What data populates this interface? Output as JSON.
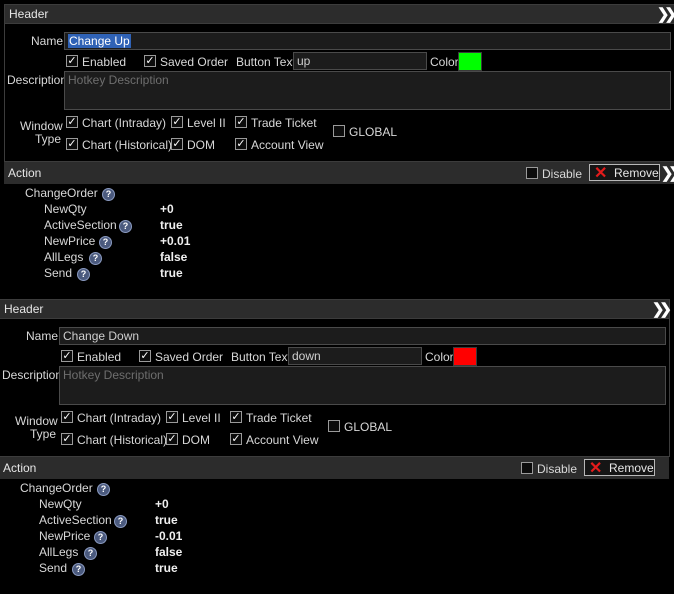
{
  "hotkeys": [
    {
      "header_title": "Header",
      "name_label": "Name",
      "name_value": "Change Up",
      "enabled_label": "Enabled",
      "enabled": true,
      "saved_order_label": "Saved Order",
      "saved_order": true,
      "button_text_label": "Button Text",
      "button_text_value": "up",
      "color_label": "Color",
      "color": "#00ff00",
      "description_label": "Description",
      "description_placeholder": "Hotkey Description",
      "window_type_label_1": "Window",
      "window_type_label_2": "Type",
      "window_types": {
        "chart_intraday": "Chart (Intraday)",
        "level2": "Level II",
        "trade_ticket": "Trade Ticket",
        "chart_historical": "Chart (Historical)",
        "dom": "DOM",
        "account_view": "Account View",
        "global": "GLOBAL"
      },
      "action_title": "Action",
      "disable_label": "Disable",
      "remove_label": "Remove",
      "action_name": "ChangeOrder",
      "params": [
        {
          "key": "NewQty",
          "value": "+0"
        },
        {
          "key": "ActiveSection",
          "value": "true"
        },
        {
          "key": "NewPrice",
          "value": "+0.01"
        },
        {
          "key": "AllLegs",
          "value": "false"
        },
        {
          "key": "Send",
          "value": "true"
        }
      ]
    },
    {
      "header_title": "Header",
      "name_label": "Name",
      "name_value": "Change Down",
      "enabled_label": "Enabled",
      "enabled": true,
      "saved_order_label": "Saved Order",
      "saved_order": true,
      "button_text_label": "Button Text",
      "button_text_value": "down",
      "color_label": "Color",
      "color": "#ff0000",
      "description_label": "Description",
      "description_placeholder": "Hotkey Description",
      "window_type_label_1": "Window",
      "window_type_label_2": "Type",
      "window_types": {
        "chart_intraday": "Chart (Intraday)",
        "level2": "Level II",
        "trade_ticket": "Trade Ticket",
        "chart_historical": "Chart (Historical)",
        "dom": "DOM",
        "account_view": "Account View",
        "global": "GLOBAL"
      },
      "action_title": "Action",
      "disable_label": "Disable",
      "remove_label": "Remove",
      "action_name": "ChangeOrder",
      "params": [
        {
          "key": "NewQty",
          "value": "+0"
        },
        {
          "key": "ActiveSection",
          "value": "true"
        },
        {
          "key": "NewPrice",
          "value": "-0.01"
        },
        {
          "key": "AllLegs",
          "value": "false"
        },
        {
          "key": "Send",
          "value": "true"
        }
      ]
    }
  ],
  "icons": {
    "expand": "double-chevron-right-icon",
    "check": "checkmark-icon",
    "remove": "red-x-icon",
    "help": "question-mark-icon"
  }
}
